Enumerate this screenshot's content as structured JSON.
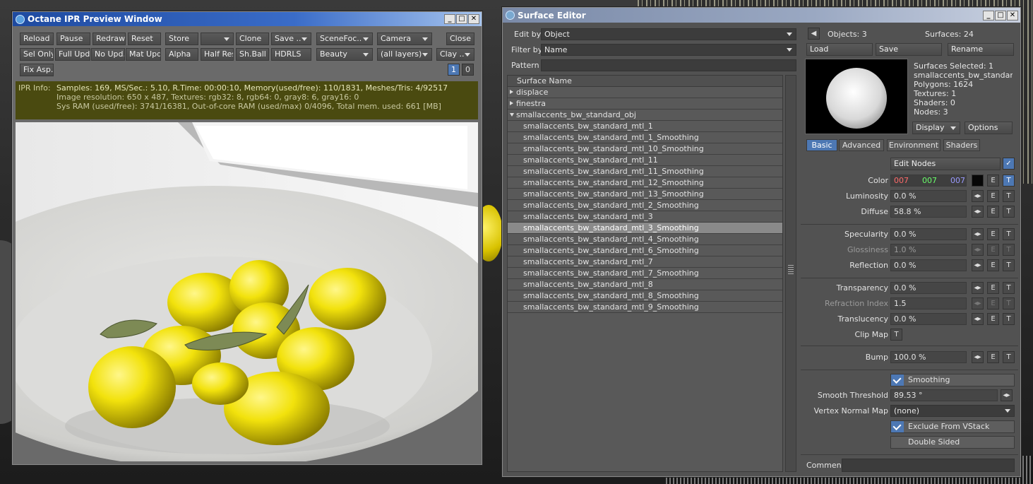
{
  "ipr": {
    "title": "Octane IPR Preview Window",
    "buttons": {
      "reload": "Reload",
      "pause": "Pause",
      "redraw": "Redraw",
      "reset": "Reset",
      "store": "Store",
      "store_slot": "",
      "clone": "Clone",
      "save": "Save ..",
      "scene_focus": "SceneFoc..",
      "camera": "Camera",
      "close": "Close",
      "sel_only": "Sel Only",
      "full_upd": "Full Upd.",
      "no_upd": "No Upd.",
      "mat_upd": "Mat Upd",
      "alpha": "Alpha",
      "half_res": "Half Res",
      "sh_ball": "Sh.Ball",
      "hdrls": "HDRLS",
      "beauty": "Beauty",
      "layers": "(all layers)",
      "clay": "Clay ..",
      "fix_asp": "Fix Asp."
    },
    "badges": [
      "1",
      "0"
    ],
    "info": {
      "label": "IPR Info:",
      "line1": "Samples: 169, MS/Sec.: 5.10, R.Time: 00:00:10, Memory(used/free): 110/1831, Meshes/Tris: 4/92517",
      "line2": "Image resolution: 650 x 487, Textures:  rgb32: 8, rgb64: 0, gray8: 6, gray16: 0",
      "line3": "Sys RAM (used/free): 3741/16381, Out-of-core RAM (used/max) 0/4096, Total mem. used: 661  [MB]"
    }
  },
  "surface_editor": {
    "title": "Surface Editor",
    "edit_by_label": "Edit by",
    "edit_by_value": "Object",
    "filter_by_label": "Filter by",
    "filter_by_value": "Name",
    "pattern_label": "Pattern",
    "pattern_value": "",
    "list_header": "Surface Name",
    "groups": [
      {
        "name": "displace",
        "open": false
      },
      {
        "name": "finestra",
        "open": false
      },
      {
        "name": "smallaccents_bw_standard_obj",
        "open": true
      }
    ],
    "surfaces": [
      "smallaccents_bw_standard_mtl_1",
      "smallaccents_bw_standard_mtl_1_Smoothing",
      "smallaccents_bw_standard_mtl_10_Smoothing",
      "smallaccents_bw_standard_mtl_11",
      "smallaccents_bw_standard_mtl_11_Smoothing",
      "smallaccents_bw_standard_mtl_12_Smoothing",
      "smallaccents_bw_standard_mtl_13_Smoothing",
      "smallaccents_bw_standard_mtl_2_Smoothing",
      "smallaccents_bw_standard_mtl_3",
      "smallaccents_bw_standard_mtl_3_Smoothing",
      "smallaccents_bw_standard_mtl_4_Smoothing",
      "smallaccents_bw_standard_mtl_6_Smoothing",
      "smallaccents_bw_standard_mtl_7",
      "smallaccents_bw_standard_mtl_7_Smoothing",
      "smallaccents_bw_standard_mtl_8",
      "smallaccents_bw_standard_mtl_8_Smoothing",
      "smallaccents_bw_standard_mtl_9_Smoothing"
    ],
    "selected_surface": "smallaccents_bw_standard_mtl_3_Smoothing",
    "objects": "Objects: 3",
    "surfaces_count": "Surfaces: 24",
    "load": "Load",
    "save": "Save",
    "rename": "Rename",
    "stats": {
      "selected": "Surfaces Selected: 1",
      "name": "smallaccents_bw_standar...",
      "polygons": "Polygons: 1624",
      "textures": "Textures: 1",
      "shaders": "Shaders: 0",
      "nodes": "Nodes: 3"
    },
    "display": "Display",
    "options": "Options",
    "tabs": [
      "Basic",
      "Advanced",
      "Environment",
      "Shaders"
    ],
    "edit_nodes": "Edit Nodes",
    "color": {
      "label": "Color",
      "r": "007",
      "g": "007",
      "b": "007",
      "r_color": "#ff6a6a",
      "g_color": "#6aff6a",
      "b_color": "#8a8aff"
    },
    "props": {
      "luminosity": {
        "label": "Luminosity",
        "value": "0.0 %"
      },
      "diffuse": {
        "label": "Diffuse",
        "value": "58.8 %"
      },
      "specularity": {
        "label": "Specularity",
        "value": "0.0 %"
      },
      "glossiness": {
        "label": "Glossiness",
        "value": "1.0 %"
      },
      "reflection": {
        "label": "Reflection",
        "value": "0.0 %"
      },
      "transparency": {
        "label": "Transparency",
        "value": "0.0 %"
      },
      "refraction": {
        "label": "Refraction Index",
        "value": "1.5"
      },
      "translucency": {
        "label": "Translucency",
        "value": "0.0 %"
      },
      "clip_map": {
        "label": "Clip Map"
      },
      "bump": {
        "label": "Bump",
        "value": "100.0 %"
      }
    },
    "smoothing": "Smoothing",
    "smooth_threshold": {
      "label": "Smooth Threshold",
      "value": "89.53 °"
    },
    "vertex_normal": {
      "label": "Vertex Normal Map",
      "value": "(none)"
    },
    "exclude_vstack": "Exclude From VStack",
    "double_sided": "Double Sided",
    "comment_label": "Comment",
    "comment_value": "",
    "e": "E",
    "t": "T"
  }
}
